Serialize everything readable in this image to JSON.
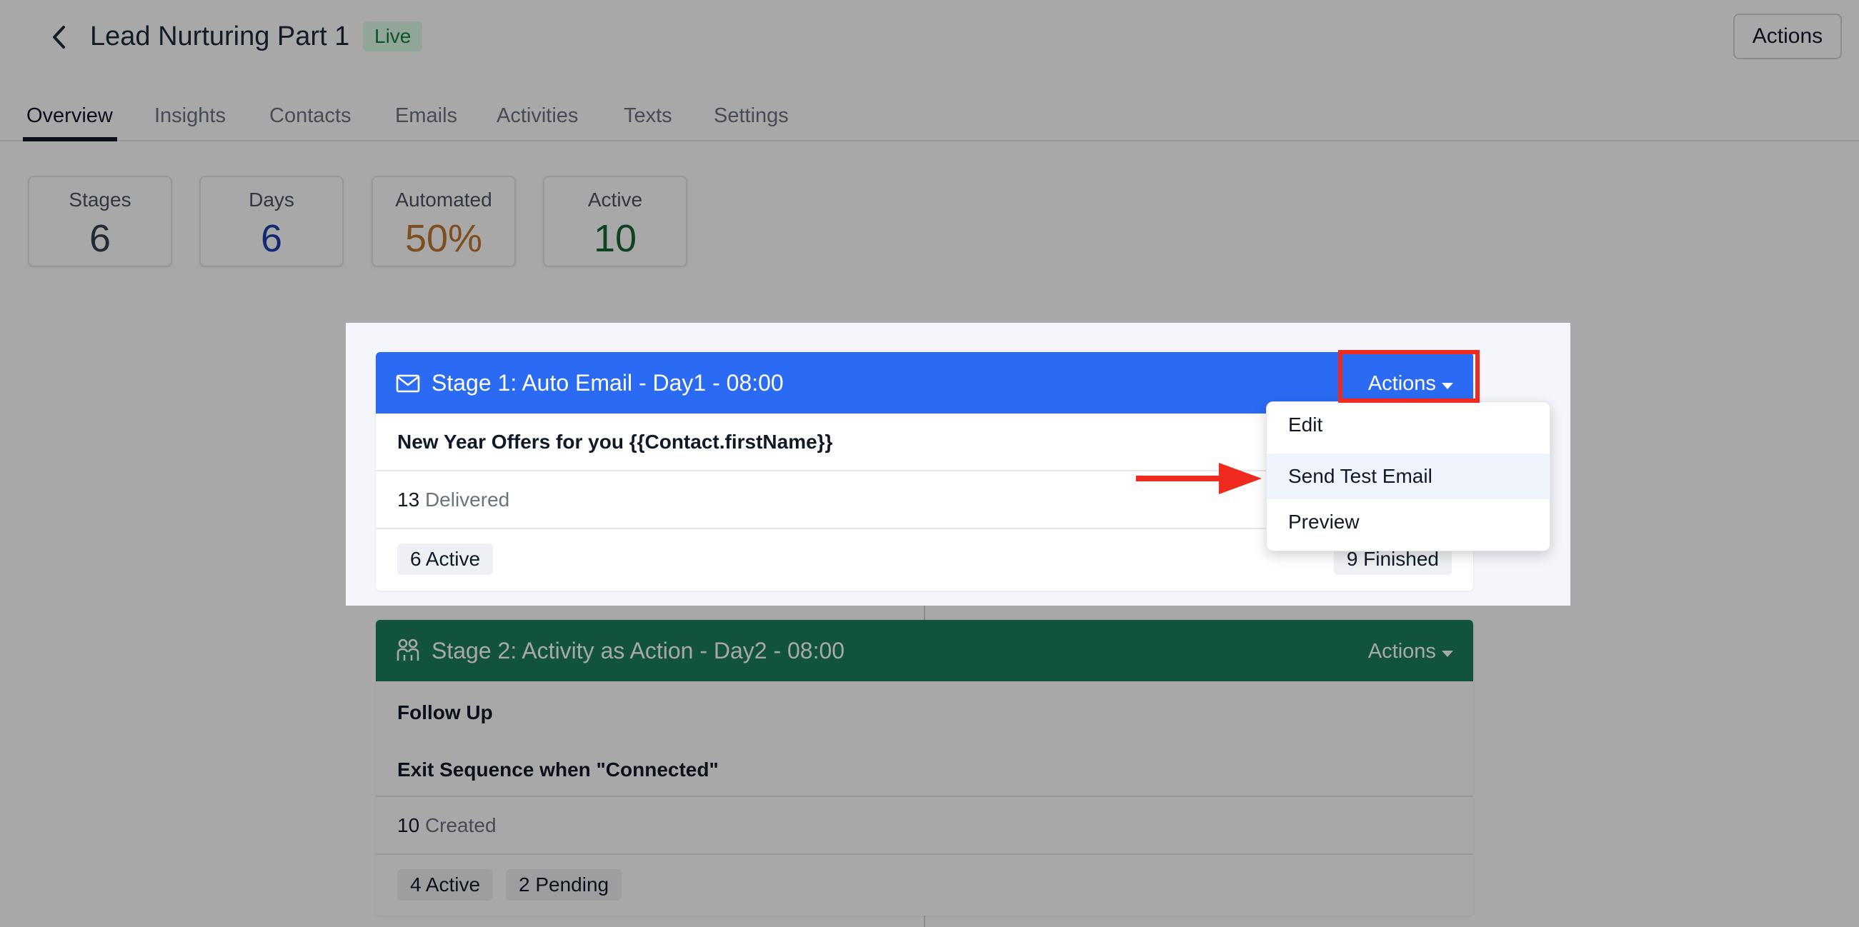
{
  "header": {
    "title": "Lead Nurturing Part 1",
    "status": "Live",
    "actions_label": "Actions"
  },
  "tabs": [
    {
      "label": "Overview",
      "active": true
    },
    {
      "label": "Insights"
    },
    {
      "label": "Contacts"
    },
    {
      "label": "Emails"
    },
    {
      "label": "Activities"
    },
    {
      "label": "Texts"
    },
    {
      "label": "Settings"
    }
  ],
  "stats": [
    {
      "label": "Stages",
      "value": "6",
      "color": "#374151"
    },
    {
      "label": "Days",
      "value": "6",
      "color": "#1e40af"
    },
    {
      "label": "Automated",
      "value": "50%",
      "color": "#c2772e"
    },
    {
      "label": "Active",
      "value": "10",
      "color": "#166534"
    }
  ],
  "stage1": {
    "title": "Stage 1: Auto Email - Day1 - 08:00",
    "icon": "envelope-icon",
    "color": "#2b6bf3",
    "actions_label": "Actions",
    "subject": "New Year Offers for you {{Contact.firstName}}",
    "delivered_count": "13",
    "delivered_label": "Delivered",
    "active_pill": "6 Active",
    "finished_pill": "9 Finished"
  },
  "stage2": {
    "title": "Stage 2: Activity as Action - Day2 - 08:00",
    "icon": "people-icon",
    "color": "#1a7f5a",
    "actions_label": "Actions",
    "activity": "Follow Up",
    "exit_rule": "Exit Sequence when \"Connected\"",
    "created_count": "10",
    "created_label": "Created",
    "active_pill": "4 Active",
    "pending_pill": "2 Pending"
  },
  "dropdown": {
    "items": [
      {
        "label": "Edit"
      },
      {
        "label": "Send Test Email",
        "hovered": true
      },
      {
        "label": "Preview"
      }
    ]
  },
  "annotation_color": "#ef2b20"
}
